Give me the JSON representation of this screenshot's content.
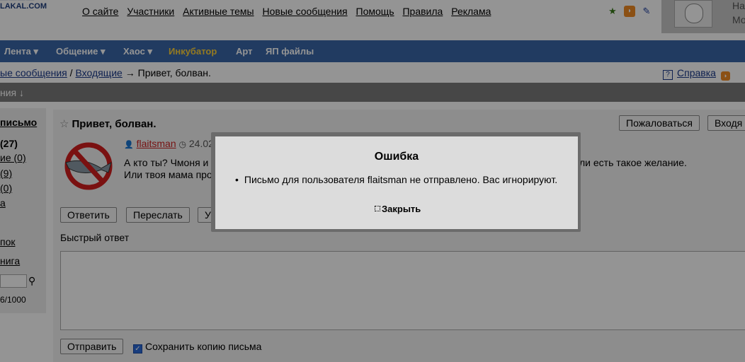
{
  "header": {
    "logo_text": "LAKAL.COM",
    "nav": [
      "О сайте",
      "Участники",
      "Активные темы",
      "Новые сообщения",
      "Помощь",
      "Правила",
      "Реклама"
    ],
    "user_line1": "На",
    "user_line2": "Мо"
  },
  "menu": [
    "Лента ▾",
    "Общение ▾",
    "Хаос ▾",
    "Инкубатор",
    "Арт",
    "ЯП файлы"
  ],
  "breadcrumb": {
    "part1": "ые сообщения",
    "sep1": " / ",
    "part2": "Входящие",
    "sep2": " → ",
    "current": "Привет, болван."
  },
  "help_label": "Справка",
  "rss_label": "RS",
  "graybar_text": "ния ↓",
  "sidebar": {
    "items": [
      "письмо",
      " (27)",
      "ие (0)",
      " (9)",
      "(0)",
      "а",
      "пок",
      "нига"
    ],
    "count": "6/1000"
  },
  "message": {
    "title": "Привет, болван.",
    "author": "flaitsman",
    "date": "24.02",
    "body_line1": "А кто ты? Чмоня и",
    "body_line1_tail": "ли есть такое желание.",
    "body_line2": "Или твоя мама про"
  },
  "buttons": {
    "complain": "Пожаловаться",
    "inbox": "Входя",
    "reply": "Ответить",
    "forward": "Переслать",
    "delete": "У",
    "send": "Отправить"
  },
  "quick_reply_label": "Быстрый ответ",
  "save_copy_label": "Сохранить копию письма",
  "modal": {
    "title": "Ошибка",
    "message": "Письмо для пользователя flaitsman не отправлено. Вас игнорируют.",
    "close": "Закрыть"
  }
}
